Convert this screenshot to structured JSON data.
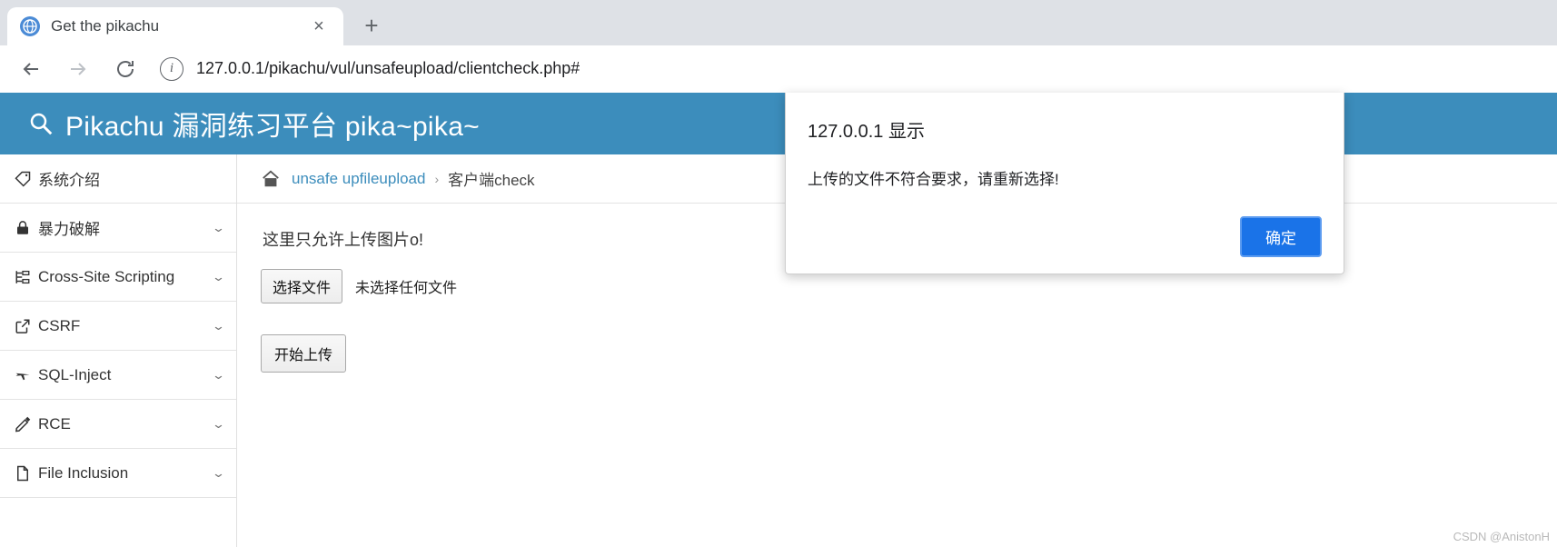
{
  "browser": {
    "tab": {
      "title": "Get the pikachu",
      "favicon": "globe-icon",
      "close_label": "×"
    },
    "new_tab_label": "+",
    "nav": {
      "back": "←",
      "forward": "→",
      "reload": "⟳"
    },
    "omnibox": {
      "info_icon": "i",
      "url": "127.0.0.1/pikachu/vul/unsafeupload/clientcheck.php#"
    }
  },
  "site": {
    "title": "Pikachu 漏洞练习平台 pika~pika~",
    "logo_icon": "search-bug-icon"
  },
  "sidebar": {
    "items": [
      {
        "label": "系统介绍",
        "icon": "tag-icon",
        "caret": ""
      },
      {
        "label": "暴力破解",
        "icon": "lock-icon",
        "caret": "⌄"
      },
      {
        "label": "Cross-Site Scripting",
        "icon": "sitemap-icon",
        "caret": "⌄"
      },
      {
        "label": "CSRF",
        "icon": "share-icon",
        "caret": "⌄"
      },
      {
        "label": "SQL-Inject",
        "icon": "plane-icon",
        "caret": "⌄"
      },
      {
        "label": "RCE",
        "icon": "pencil-icon",
        "caret": "⌄"
      },
      {
        "label": "File Inclusion",
        "icon": "file-icon",
        "caret": "⌄"
      }
    ]
  },
  "breadcrumb": {
    "home_icon": "home-icon",
    "link": "unsafe upfileupload",
    "separator": "›",
    "current": "客户端check"
  },
  "main": {
    "hint": "这里只允许上传图片o!",
    "choose_file_label": "选择文件",
    "file_status": "未选择任何文件",
    "submit_label": "开始上传"
  },
  "dialog": {
    "title": "127.0.0.1 显示",
    "message": "上传的文件不符合要求，请重新选择!",
    "ok_label": "确定"
  },
  "watermark": "CSDN @AnistonH",
  "colors": {
    "brand": "#3c8dbc",
    "tabstrip": "#dee1e6",
    "accent_button": "#1a73e8",
    "link": "#3c8dbc"
  }
}
